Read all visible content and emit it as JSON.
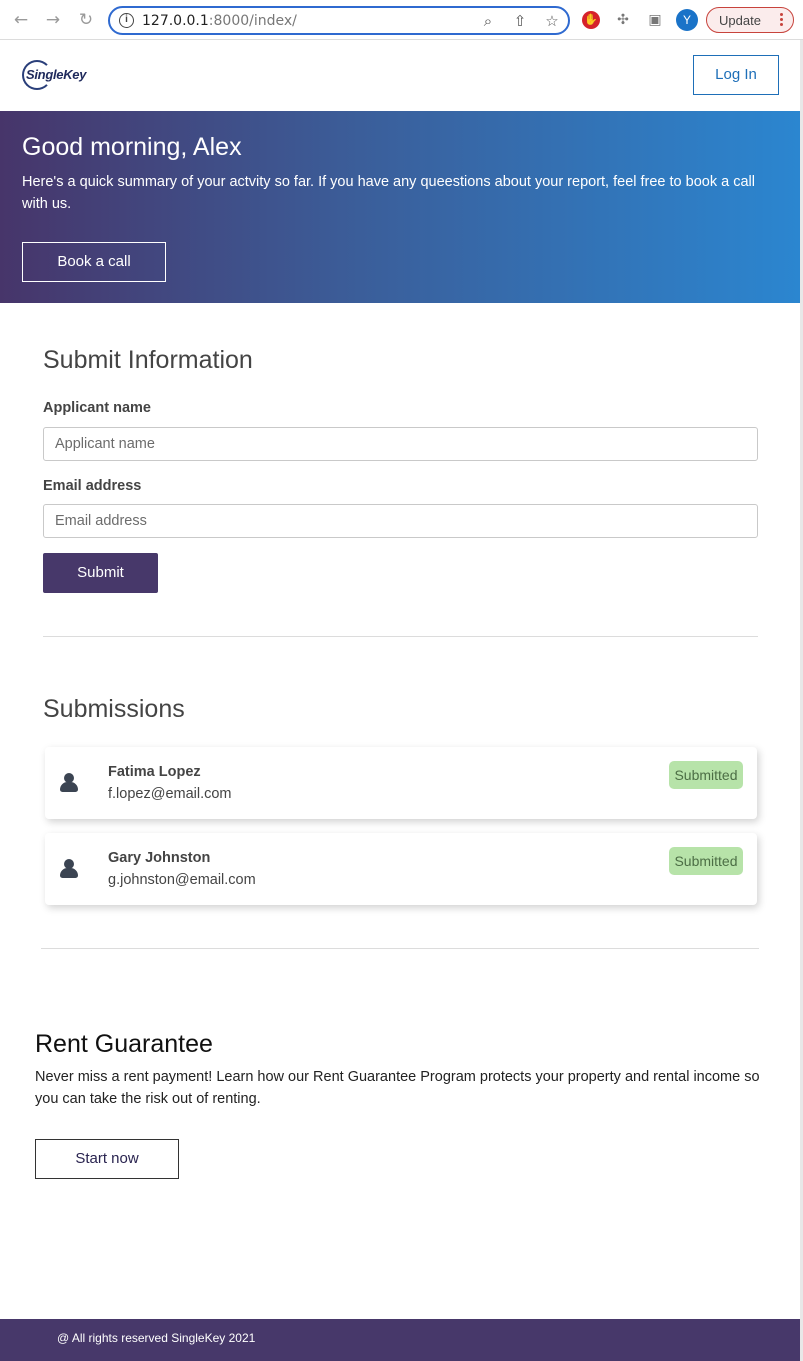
{
  "browser": {
    "url_host": "127.0.0.1",
    "url_rest": ":8000/index/",
    "profile_initial": "Y",
    "update_label": "Update"
  },
  "header": {
    "logo_text": "SingleKey",
    "login_label": "Log In"
  },
  "hero": {
    "title": "Good morning, Alex",
    "text": "Here's a quick summary of your actvity so far. If you have any queestions about your report, feel free to book a call with us.",
    "button_label": "Book a call"
  },
  "form": {
    "title": "Submit Information",
    "name_label": "Applicant name",
    "name_placeholder": "Applicant name",
    "email_label": "Email address",
    "email_placeholder": "Email address",
    "submit_label": "Submit"
  },
  "submissions": {
    "title": "Submissions",
    "items": [
      {
        "name": "Fatima Lopez",
        "email": "f.lopez@email.com",
        "status": "Submitted"
      },
      {
        "name": "Gary Johnston",
        "email": "g.johnston@email.com",
        "status": "Submitted"
      }
    ]
  },
  "rent_guarantee": {
    "title": "Rent Guarantee",
    "text": "Never miss a rent payment! Learn how our Rent Guarantee Program protects your property and rental income so you can take the risk out of renting.",
    "button_label": "Start now"
  },
  "footer": {
    "text": "@ All rights reserved SingleKey 2021"
  },
  "colors": {
    "brand_purple": "#47386a",
    "link_blue": "#1e6fb8",
    "status_green": "#b7e3a9"
  }
}
